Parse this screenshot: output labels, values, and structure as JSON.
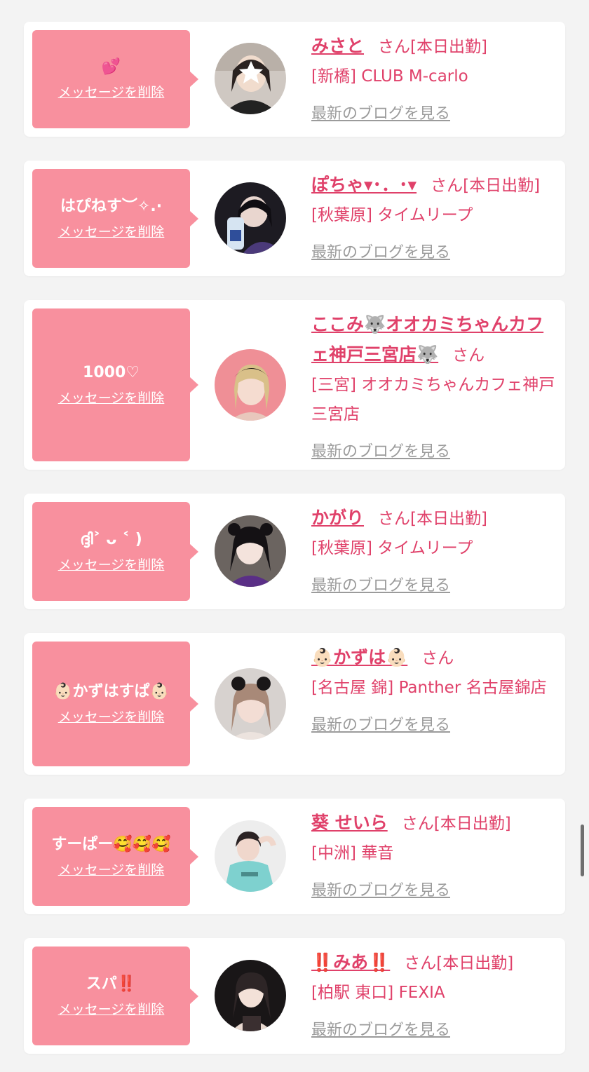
{
  "delete_label": "メッセージを削除",
  "blog_label": "最新のブログを見る",
  "san_label": "さん",
  "colors": {
    "bubble": "#f8909e",
    "accent": "#e0416a",
    "muted": "#9b9b9b"
  },
  "cards": [
    {
      "message": "💕",
      "name": "みさと",
      "status": "[本日出勤]",
      "shop": "[新橋] CLUB M-carlo"
    },
    {
      "message": "はぴねす︶✧.·",
      "name": "ぽちゃ▾･．･▾",
      "status": "[本日出勤]",
      "shop": "[秋葉原] タイムリープ"
    },
    {
      "message": "1000♡",
      "name": "ここみ🐺オオカミちゃんカフェ神戸三宮店🐺",
      "status": "",
      "shop": "[三宮] オオカミちゃんカフェ神戸三宮店"
    },
    {
      "message": "ദ്ദി˃ ᴗ ˂ )",
      "name": "かがり",
      "status": "[本日出勤]",
      "shop": "[秋葉原] タイムリープ"
    },
    {
      "message": "👶🏻かずはすぱ👶🏻",
      "name": "👶🏻かずは👶🏻",
      "status": "",
      "shop": "[名古屋 錦] Panther 名古屋錦店"
    },
    {
      "message": "すーぱー🥰🥰🥰",
      "name": "葵 せいら",
      "status": "[本日出勤]",
      "shop": "[中洲] 華音"
    },
    {
      "message": "スパ‼️",
      "name": "‼️みあ‼️",
      "status": "[本日出勤]",
      "shop": "[柏駅 東口] FEXIA"
    }
  ]
}
